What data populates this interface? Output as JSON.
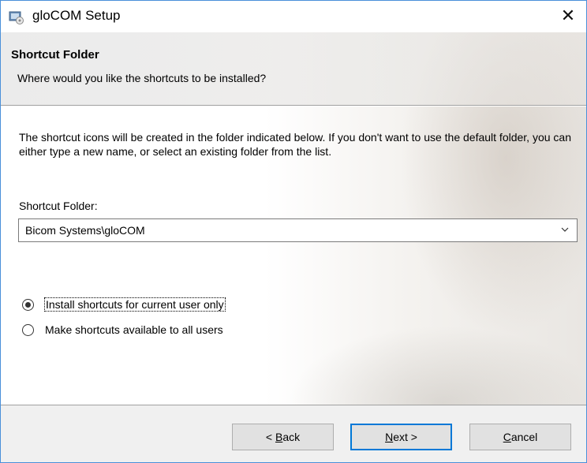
{
  "window": {
    "title": "gloCOM Setup",
    "close_glyph": "✕",
    "icon": "installer-icon"
  },
  "header": {
    "title": "Shortcut Folder",
    "subtitle": "Where would you like the shortcuts to be installed?"
  },
  "body": {
    "description": "The shortcut icons will be created in the folder indicated below. If you don't want to use the default folder, you can either type a new name, or select an existing folder from the list.",
    "folder_label": "Shortcut Folder:",
    "folder_value": "Bicom Systems\\gloCOM"
  },
  "options": [
    {
      "label": "Install shortcuts for current user only",
      "selected": true
    },
    {
      "label": "Make shortcuts available to all users",
      "selected": false
    }
  ],
  "buttons": {
    "back": {
      "prefix": "< ",
      "mnemonic": "B",
      "rest": "ack"
    },
    "next": {
      "mnemonic": "N",
      "rest": "ext >"
    },
    "cancel": {
      "mnemonic": "C",
      "rest": "ancel"
    }
  },
  "colors": {
    "accent": "#0078d7",
    "window_border": "#4a90d9",
    "footer_bg": "#f0f0f0"
  }
}
